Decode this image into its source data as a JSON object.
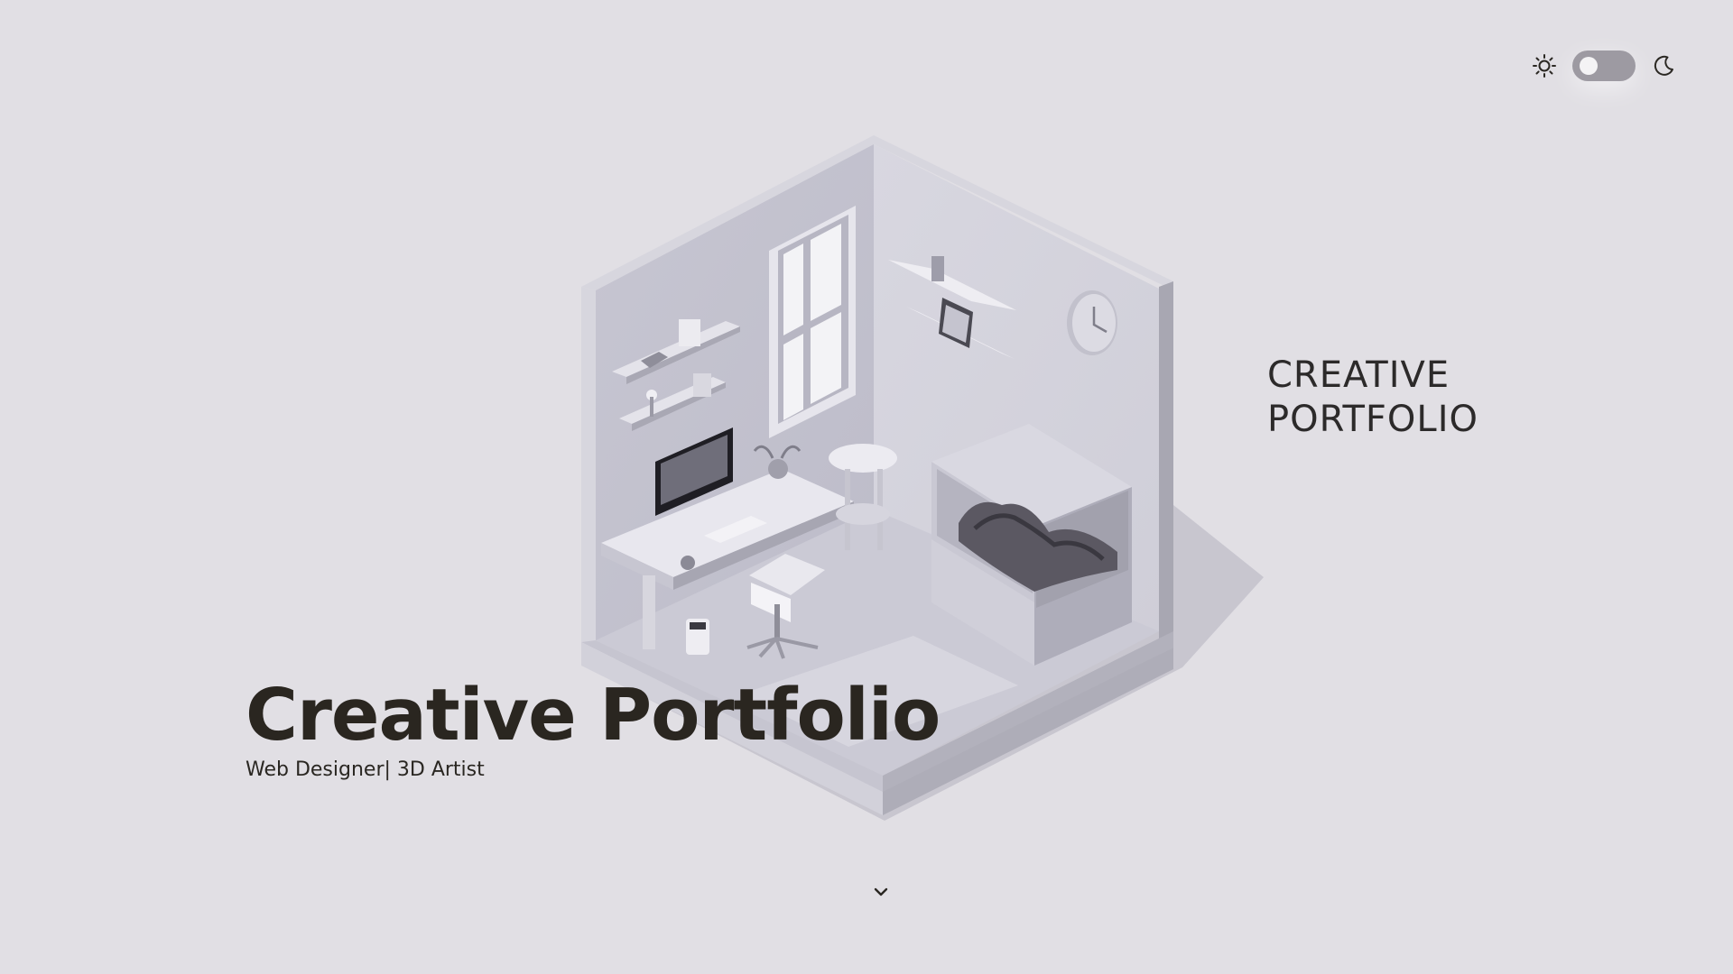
{
  "theme_toggle": {
    "light_icon": "sun-icon",
    "dark_icon": "moon-icon",
    "state": "light"
  },
  "side_title": {
    "line1": "CREATIVE",
    "line2": "PORTFOLIO"
  },
  "hero": {
    "title": "Creative Portfolio",
    "subtitle": "Web Designer| 3D Artist"
  },
  "scroll": {
    "icon": "chevron-down-icon"
  },
  "colors": {
    "background": "#e1dfe4",
    "text": "#2a2620",
    "toggle_track": "#9d9aa2"
  }
}
